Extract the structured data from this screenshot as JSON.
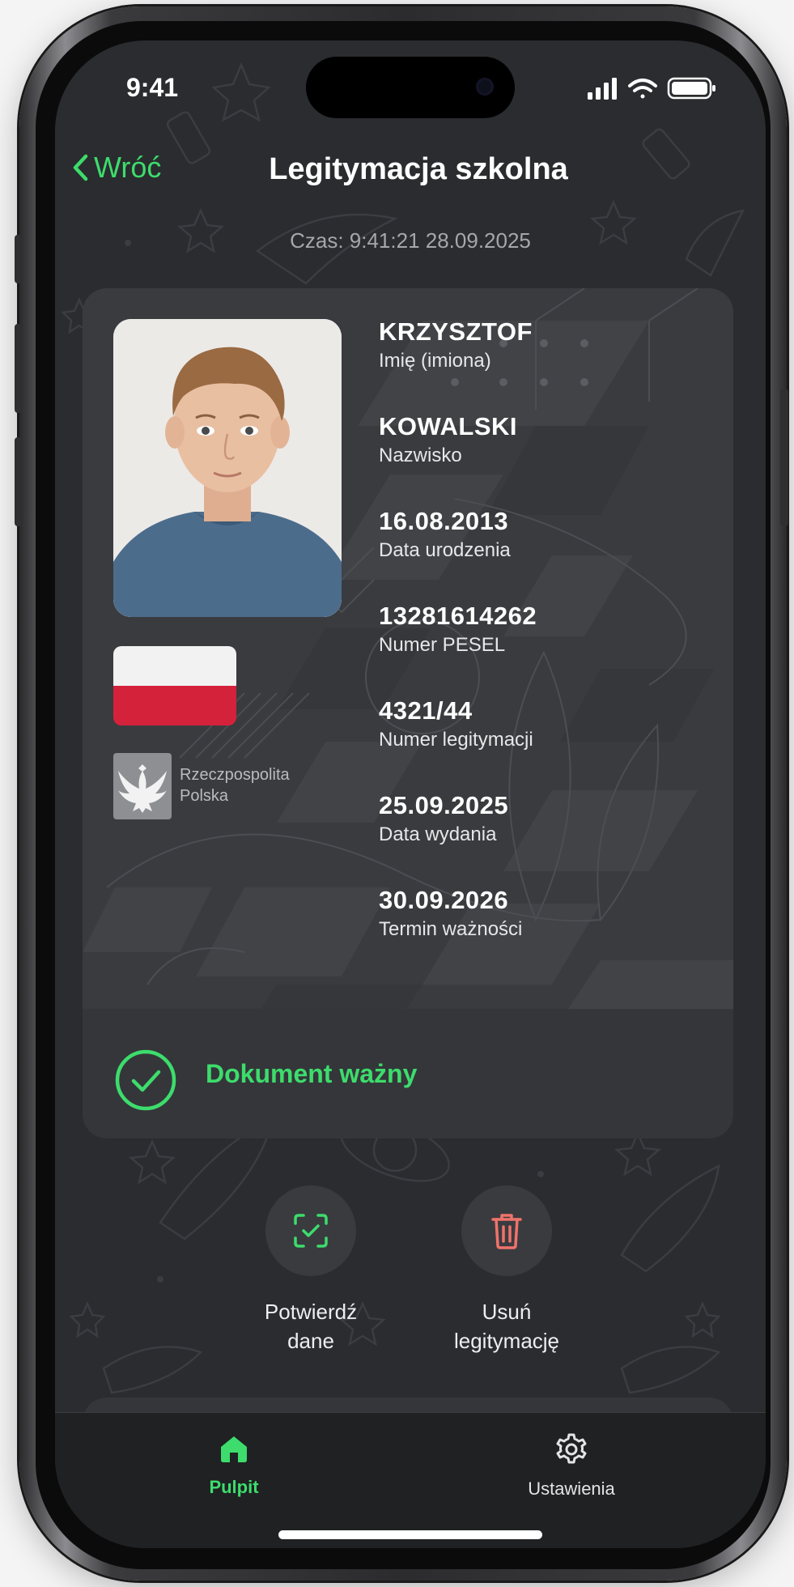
{
  "status_bar": {
    "time": "9:41"
  },
  "nav": {
    "back_label": "Wróć",
    "title": "Legitymacja szkolna"
  },
  "timestamp": "Czas: 9:41:21 28.09.2025",
  "card": {
    "country": {
      "line1": "Rzeczpospolita",
      "line2": "Polska"
    },
    "fields": [
      {
        "value": "KRZYSZTOF",
        "label": "Imię (imiona)"
      },
      {
        "value": "KOWALSKI",
        "label": "Nazwisko"
      },
      {
        "value": "16.08.2013",
        "label": "Data urodzenia"
      },
      {
        "value": "13281614262",
        "label": "Numer PESEL"
      },
      {
        "value": "4321/44",
        "label": "Numer legitymacji"
      },
      {
        "value": "25.09.2025",
        "label": "Data wydania"
      },
      {
        "value": "30.09.2026",
        "label": "Termin ważności"
      }
    ],
    "status": "Dokument ważny"
  },
  "actions": {
    "confirm": {
      "line1": "Potwierdź",
      "line2": "dane"
    },
    "delete": {
      "line1": "Usuń",
      "line2": "legitymację"
    }
  },
  "tabs": [
    {
      "label": "Pulpit",
      "active": true
    },
    {
      "label": "Ustawienia",
      "active": false
    }
  ],
  "colors": {
    "accent": "#3ddc6c",
    "danger": "#f0736a",
    "flag_red": "#d5223b",
    "background": "#2a2c2f",
    "card": "#393b3f"
  }
}
